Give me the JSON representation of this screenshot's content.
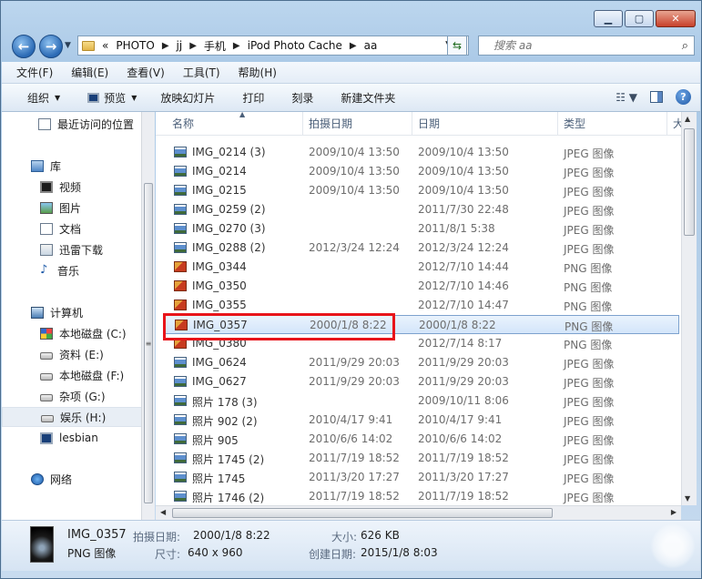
{
  "address": {
    "crumbs": [
      "PHOTO",
      "jj",
      "手机",
      "iPod Photo Cache",
      "aa"
    ],
    "leading": "«"
  },
  "search": {
    "placeholder": "搜索 aa"
  },
  "menu": [
    "文件(F)",
    "编辑(E)",
    "查看(V)",
    "工具(T)",
    "帮助(H)"
  ],
  "toolbar": {
    "organize": "组织",
    "preview": "预览",
    "slideshow": "放映幻灯片",
    "print": "打印",
    "burn": "刻录",
    "new_folder": "新建文件夹"
  },
  "sidebar": {
    "recent": "最近访问的位置",
    "library": "库",
    "videos": "视频",
    "pictures": "图片",
    "documents": "文档",
    "thunder": "迅雷下载",
    "music": "音乐",
    "computer": "计算机",
    "drive_c": "本地磁盘 (C:)",
    "drive_e": "资料 (E:)",
    "drive_f": "本地磁盘 (F:)",
    "drive_g": "杂项 (G:)",
    "drive_h": "娱乐 (H:)",
    "lesbian": "lesbian",
    "network": "网络"
  },
  "columns": {
    "name": "名称",
    "taken": "拍摄日期",
    "date": "日期",
    "type": "类型",
    "extra": "大"
  },
  "files": [
    {
      "name": "IMG_0214 (3)",
      "taken": "2009/10/4 13:50",
      "date": "2009/10/4 13:50",
      "type": "JPEG 图像",
      "kind": "jpeg"
    },
    {
      "name": "IMG_0214",
      "taken": "2009/10/4 13:50",
      "date": "2009/10/4 13:50",
      "type": "JPEG 图像",
      "kind": "jpeg"
    },
    {
      "name": "IMG_0215",
      "taken": "2009/10/4 13:50",
      "date": "2009/10/4 13:50",
      "type": "JPEG 图像",
      "kind": "jpeg"
    },
    {
      "name": "IMG_0259 (2)",
      "taken": "",
      "date": "2011/7/30 22:48",
      "type": "JPEG 图像",
      "kind": "jpeg"
    },
    {
      "name": "IMG_0270 (3)",
      "taken": "",
      "date": "2011/8/1 5:38",
      "type": "JPEG 图像",
      "kind": "jpeg"
    },
    {
      "name": "IMG_0288 (2)",
      "taken": "2012/3/24 12:24",
      "date": "2012/3/24 12:24",
      "type": "JPEG 图像",
      "kind": "jpeg"
    },
    {
      "name": "IMG_0344",
      "taken": "",
      "date": "2012/7/10 14:44",
      "type": "PNG 图像",
      "kind": "png"
    },
    {
      "name": "IMG_0350",
      "taken": "",
      "date": "2012/7/10 14:46",
      "type": "PNG 图像",
      "kind": "png"
    },
    {
      "name": "IMG_0355",
      "taken": "",
      "date": "2012/7/10 14:47",
      "type": "PNG 图像",
      "kind": "png"
    },
    {
      "name": "IMG_0357",
      "taken": "2000/1/8 8:22",
      "date": "2000/1/8 8:22",
      "type": "PNG 图像",
      "kind": "png",
      "selected": true
    },
    {
      "name": "IMG_0380",
      "taken": "",
      "date": "2012/7/14 8:17",
      "type": "PNG 图像",
      "kind": "png"
    },
    {
      "name": "IMG_0624",
      "taken": "2011/9/29 20:03",
      "date": "2011/9/29 20:03",
      "type": "JPEG 图像",
      "kind": "jpeg"
    },
    {
      "name": "IMG_0627",
      "taken": "2011/9/29 20:03",
      "date": "2011/9/29 20:03",
      "type": "JPEG 图像",
      "kind": "jpeg"
    },
    {
      "name": "照片 178 (3)",
      "taken": "",
      "date": "2009/10/11 8:06",
      "type": "JPEG 图像",
      "kind": "jpeg"
    },
    {
      "name": "照片 902 (2)",
      "taken": "2010/4/17 9:41",
      "date": "2010/4/17 9:41",
      "type": "JPEG 图像",
      "kind": "jpeg"
    },
    {
      "name": "照片 905",
      "taken": "2010/6/6 14:02",
      "date": "2010/6/6 14:02",
      "type": "JPEG 图像",
      "kind": "jpeg"
    },
    {
      "name": "照片 1745 (2)",
      "taken": "2011/7/19 18:52",
      "date": "2011/7/19 18:52",
      "type": "JPEG 图像",
      "kind": "jpeg"
    },
    {
      "name": "照片 1745",
      "taken": "2011/3/20 17:27",
      "date": "2011/3/20 17:27",
      "type": "JPEG 图像",
      "kind": "jpeg"
    },
    {
      "name": "照片 1746 (2)",
      "taken": "2011/7/19 18:52",
      "date": "2011/7/19 18:52",
      "type": "JPEG 图像",
      "kind": "jpeg"
    }
  ],
  "details": {
    "name": "IMG_0357",
    "type": "PNG 图像",
    "taken_label": "拍摄日期:",
    "taken": "2000/1/8 8:22",
    "dims_label": "尺寸:",
    "dims": "640 x 960",
    "size_label": "大小:",
    "size": "626 KB",
    "created_label": "创建日期:",
    "created": "2015/1/8 8:03"
  }
}
